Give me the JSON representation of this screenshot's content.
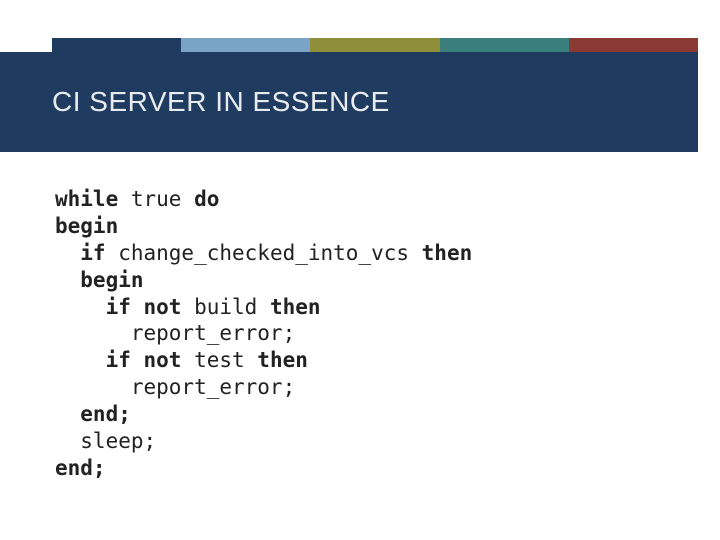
{
  "title": "CI SERVER IN ESSENCE",
  "code": {
    "l1a": "while",
    "l1b": " true ",
    "l1c": "do",
    "l2": "begin",
    "l3a": "  if",
    "l3b": " change_checked_into_vcs ",
    "l3c": "then",
    "l4": "  begin",
    "l5a": "    if not",
    "l5b": " build ",
    "l5c": "then",
    "l6": "      report_error;",
    "l7a": "    if not",
    "l7b": " test ",
    "l7c": "then",
    "l8": "      report_error;",
    "l9": "  end;",
    "l10": "  sleep;",
    "l11": "end;"
  }
}
